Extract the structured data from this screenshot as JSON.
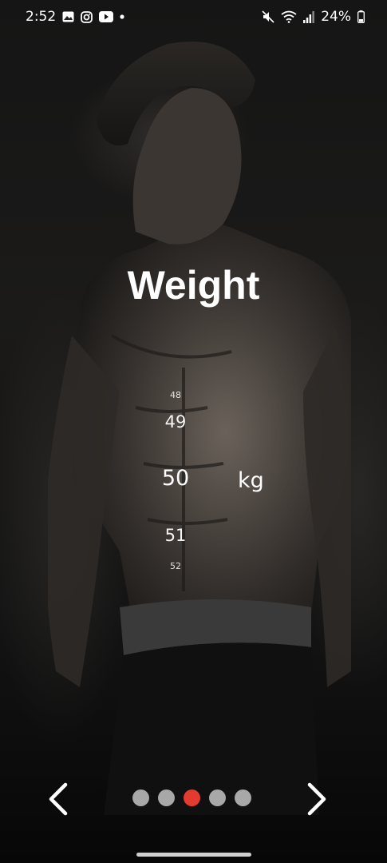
{
  "status_bar": {
    "time": "2:52",
    "battery": "24%",
    "icons": [
      "gallery-icon",
      "instagram-icon",
      "youtube-icon",
      "dot-icon",
      "mute-icon",
      "wifi-icon",
      "signal-icon",
      "battery-icon"
    ]
  },
  "screen": {
    "title": "Weight",
    "picker": {
      "values": [
        "48",
        "49",
        "50",
        "51",
        "52"
      ],
      "selected": "50",
      "unit": "kg"
    }
  },
  "nav": {
    "prev_icon": "chevron-left-icon",
    "next_icon": "chevron-right-icon",
    "page_count": 5,
    "active_page": 3
  },
  "colors": {
    "accent": "#e23b2f",
    "dot_inactive": "#a8a8a8",
    "text": "#ffffff"
  }
}
